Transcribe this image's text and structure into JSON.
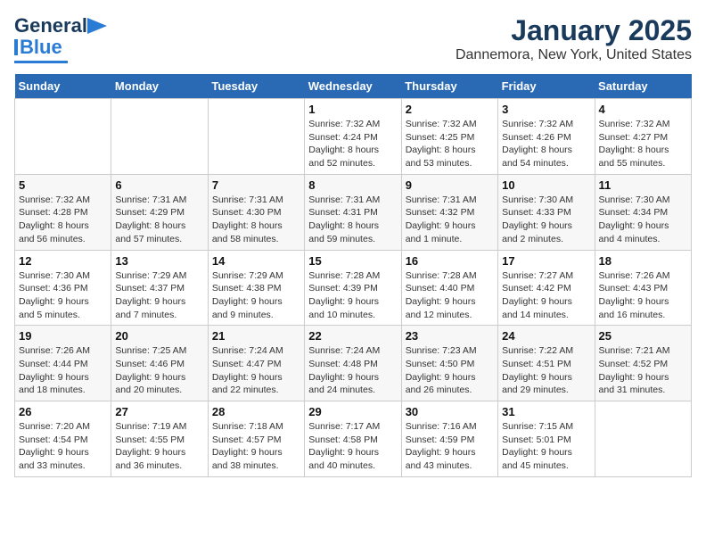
{
  "header": {
    "logo_general": "General",
    "logo_blue": "Blue",
    "title": "January 2025",
    "subtitle": "Dannemora, New York, United States"
  },
  "weekdays": [
    "Sunday",
    "Monday",
    "Tuesday",
    "Wednesday",
    "Thursday",
    "Friday",
    "Saturday"
  ],
  "weeks": [
    [
      {
        "day": "",
        "info": ""
      },
      {
        "day": "",
        "info": ""
      },
      {
        "day": "",
        "info": ""
      },
      {
        "day": "1",
        "info": "Sunrise: 7:32 AM\nSunset: 4:24 PM\nDaylight: 8 hours\nand 52 minutes."
      },
      {
        "day": "2",
        "info": "Sunrise: 7:32 AM\nSunset: 4:25 PM\nDaylight: 8 hours\nand 53 minutes."
      },
      {
        "day": "3",
        "info": "Sunrise: 7:32 AM\nSunset: 4:26 PM\nDaylight: 8 hours\nand 54 minutes."
      },
      {
        "day": "4",
        "info": "Sunrise: 7:32 AM\nSunset: 4:27 PM\nDaylight: 8 hours\nand 55 minutes."
      }
    ],
    [
      {
        "day": "5",
        "info": "Sunrise: 7:32 AM\nSunset: 4:28 PM\nDaylight: 8 hours\nand 56 minutes."
      },
      {
        "day": "6",
        "info": "Sunrise: 7:31 AM\nSunset: 4:29 PM\nDaylight: 8 hours\nand 57 minutes."
      },
      {
        "day": "7",
        "info": "Sunrise: 7:31 AM\nSunset: 4:30 PM\nDaylight: 8 hours\nand 58 minutes."
      },
      {
        "day": "8",
        "info": "Sunrise: 7:31 AM\nSunset: 4:31 PM\nDaylight: 8 hours\nand 59 minutes."
      },
      {
        "day": "9",
        "info": "Sunrise: 7:31 AM\nSunset: 4:32 PM\nDaylight: 9 hours\nand 1 minute."
      },
      {
        "day": "10",
        "info": "Sunrise: 7:30 AM\nSunset: 4:33 PM\nDaylight: 9 hours\nand 2 minutes."
      },
      {
        "day": "11",
        "info": "Sunrise: 7:30 AM\nSunset: 4:34 PM\nDaylight: 9 hours\nand 4 minutes."
      }
    ],
    [
      {
        "day": "12",
        "info": "Sunrise: 7:30 AM\nSunset: 4:36 PM\nDaylight: 9 hours\nand 5 minutes."
      },
      {
        "day": "13",
        "info": "Sunrise: 7:29 AM\nSunset: 4:37 PM\nDaylight: 9 hours\nand 7 minutes."
      },
      {
        "day": "14",
        "info": "Sunrise: 7:29 AM\nSunset: 4:38 PM\nDaylight: 9 hours\nand 9 minutes."
      },
      {
        "day": "15",
        "info": "Sunrise: 7:28 AM\nSunset: 4:39 PM\nDaylight: 9 hours\nand 10 minutes."
      },
      {
        "day": "16",
        "info": "Sunrise: 7:28 AM\nSunset: 4:40 PM\nDaylight: 9 hours\nand 12 minutes."
      },
      {
        "day": "17",
        "info": "Sunrise: 7:27 AM\nSunset: 4:42 PM\nDaylight: 9 hours\nand 14 minutes."
      },
      {
        "day": "18",
        "info": "Sunrise: 7:26 AM\nSunset: 4:43 PM\nDaylight: 9 hours\nand 16 minutes."
      }
    ],
    [
      {
        "day": "19",
        "info": "Sunrise: 7:26 AM\nSunset: 4:44 PM\nDaylight: 9 hours\nand 18 minutes."
      },
      {
        "day": "20",
        "info": "Sunrise: 7:25 AM\nSunset: 4:46 PM\nDaylight: 9 hours\nand 20 minutes."
      },
      {
        "day": "21",
        "info": "Sunrise: 7:24 AM\nSunset: 4:47 PM\nDaylight: 9 hours\nand 22 minutes."
      },
      {
        "day": "22",
        "info": "Sunrise: 7:24 AM\nSunset: 4:48 PM\nDaylight: 9 hours\nand 24 minutes."
      },
      {
        "day": "23",
        "info": "Sunrise: 7:23 AM\nSunset: 4:50 PM\nDaylight: 9 hours\nand 26 minutes."
      },
      {
        "day": "24",
        "info": "Sunrise: 7:22 AM\nSunset: 4:51 PM\nDaylight: 9 hours\nand 29 minutes."
      },
      {
        "day": "25",
        "info": "Sunrise: 7:21 AM\nSunset: 4:52 PM\nDaylight: 9 hours\nand 31 minutes."
      }
    ],
    [
      {
        "day": "26",
        "info": "Sunrise: 7:20 AM\nSunset: 4:54 PM\nDaylight: 9 hours\nand 33 minutes."
      },
      {
        "day": "27",
        "info": "Sunrise: 7:19 AM\nSunset: 4:55 PM\nDaylight: 9 hours\nand 36 minutes."
      },
      {
        "day": "28",
        "info": "Sunrise: 7:18 AM\nSunset: 4:57 PM\nDaylight: 9 hours\nand 38 minutes."
      },
      {
        "day": "29",
        "info": "Sunrise: 7:17 AM\nSunset: 4:58 PM\nDaylight: 9 hours\nand 40 minutes."
      },
      {
        "day": "30",
        "info": "Sunrise: 7:16 AM\nSunset: 4:59 PM\nDaylight: 9 hours\nand 43 minutes."
      },
      {
        "day": "31",
        "info": "Sunrise: 7:15 AM\nSunset: 5:01 PM\nDaylight: 9 hours\nand 45 minutes."
      },
      {
        "day": "",
        "info": ""
      }
    ]
  ]
}
